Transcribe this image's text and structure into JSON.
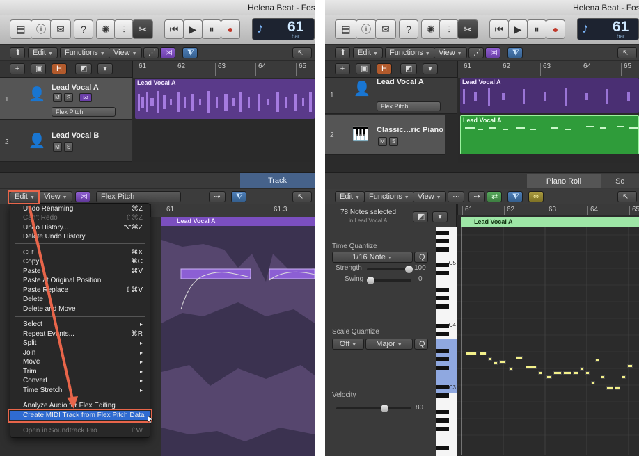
{
  "left": {
    "title": "Helena Beat - Foste",
    "lcd": {
      "bar": "61",
      "bar_label": "bar"
    },
    "edit_bar": {
      "edit": "Edit",
      "functions": "Functions",
      "view": "View"
    },
    "header_btns": {
      "h": "H"
    },
    "ruler": [
      "61",
      "62",
      "63",
      "64",
      "65"
    ],
    "tracks": [
      {
        "num": "1",
        "name": "Lead Vocal A",
        "m": "M",
        "s": "S",
        "popup": "Flex Pitch",
        "region": "Lead Vocal A"
      },
      {
        "num": "2",
        "name": "Lead Vocal B",
        "m": "M",
        "s": "S"
      }
    ],
    "tab": "Track",
    "editor_bar": {
      "edit": "Edit",
      "view": "View",
      "mode": "Flex Pitch"
    },
    "editor_ruler": [
      "61",
      "61.3"
    ],
    "editor_region": "Lead Vocal A",
    "menu": [
      {
        "label": "Undo Renaming",
        "sc": "⌘Z",
        "dis": false
      },
      {
        "label": "Can't Redo",
        "sc": "⇧⌘Z",
        "dis": true
      },
      {
        "label": "Undo History...",
        "sc": "⌥⌘Z",
        "dis": false
      },
      {
        "label": "Delete Undo History",
        "sc": "",
        "dis": false
      },
      {
        "label": "Cut",
        "sc": "⌘X",
        "dis": false
      },
      {
        "label": "Copy",
        "sc": "⌘C",
        "dis": false
      },
      {
        "label": "Paste",
        "sc": "⌘V",
        "dis": false
      },
      {
        "label": "Paste at Original Position",
        "sc": "",
        "dis": false
      },
      {
        "label": "Paste Replace",
        "sc": "⇧⌘V",
        "dis": false
      },
      {
        "label": "Delete",
        "sc": "",
        "dis": false
      },
      {
        "label": "Delete and Move",
        "sc": "",
        "dis": false
      },
      {
        "label": "Select",
        "sc": "▸",
        "dis": false
      },
      {
        "label": "Repeat Events...",
        "sc": "⌘R",
        "dis": false
      },
      {
        "label": "Split",
        "sc": "▸",
        "dis": false
      },
      {
        "label": "Join",
        "sc": "▸",
        "dis": false
      },
      {
        "label": "Move",
        "sc": "▸",
        "dis": false
      },
      {
        "label": "Trim",
        "sc": "▸",
        "dis": false
      },
      {
        "label": "Convert",
        "sc": "▸",
        "dis": false
      },
      {
        "label": "Time Stretch",
        "sc": "▸",
        "dis": false
      },
      {
        "label": "Analyze Audio for Flex Editing",
        "sc": "",
        "dis": false
      },
      {
        "label": "Create MIDI Track from Flex Pitch Data",
        "sc": "",
        "dis": false
      },
      {
        "label": "Open in Soundtrack Pro",
        "sc": "⇧W",
        "dis": true
      }
    ]
  },
  "right": {
    "title": "Helena Beat - Foste",
    "lcd": {
      "bar": "61",
      "bar_label": "bar"
    },
    "edit_bar": {
      "edit": "Edit",
      "functions": "Functions",
      "view": "View"
    },
    "header_btns": {
      "h": "H"
    },
    "ruler": [
      "61",
      "62",
      "63",
      "64",
      "65"
    ],
    "tracks": [
      {
        "num": "1",
        "name": "Lead Vocal A",
        "popup": "Flex Pitch",
        "region": "Lead Vocal A"
      },
      {
        "num": "2",
        "name": "Classic…ric Piano",
        "m": "M",
        "s": "S",
        "region": "Lead Vocal A"
      }
    ],
    "tabs": [
      "Piano Roll",
      "Sc"
    ],
    "editor_bar": {
      "edit": "Edit",
      "functions": "Functions",
      "view": "View"
    },
    "notes_selected": "78 Notes selected",
    "notes_in": "in Lead Vocal A",
    "editor_ruler": [
      "61",
      "62",
      "63",
      "64",
      "65"
    ],
    "editor_region": "Lead Vocal A",
    "time_quantize": {
      "label": "Time Quantize",
      "value": "1/16 Note",
      "q": "Q",
      "strength_label": "Strength",
      "strength": "100",
      "swing_label": "Swing",
      "swing": "0"
    },
    "scale_quantize": {
      "label": "Scale Quantize",
      "off": "Off",
      "scale": "Major",
      "q": "Q"
    },
    "velocity": {
      "label": "Velocity",
      "value": "80"
    },
    "key_labels": [
      "C5",
      "C4",
      "C3"
    ]
  }
}
